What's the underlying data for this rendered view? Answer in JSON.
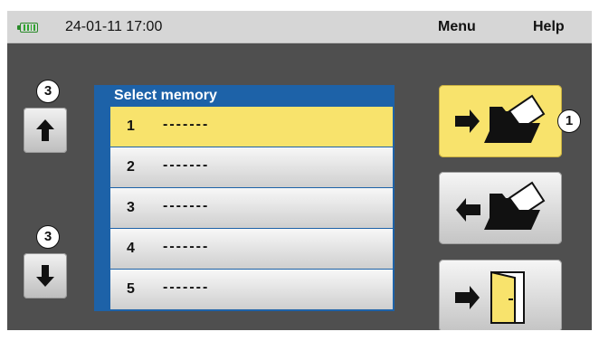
{
  "status_bar": {
    "datetime": "24-01-11 17:00",
    "menu_label": "Menu",
    "help_label": "Help",
    "battery_icon": "battery-icon"
  },
  "callouts": {
    "up": "3",
    "down": "3",
    "save": "1"
  },
  "memory_list": {
    "title": "Select memory",
    "selected_index": 0,
    "items": [
      {
        "number": "1",
        "value": "-------"
      },
      {
        "number": "2",
        "value": "-------"
      },
      {
        "number": "3",
        "value": "-------"
      },
      {
        "number": "4",
        "value": "-------"
      },
      {
        "number": "5",
        "value": "-------"
      }
    ]
  },
  "buttons": {
    "scroll_up_icon": "arrow-up-icon",
    "scroll_down_icon": "arrow-down-icon",
    "save_icon": "arrow-into-folder-icon",
    "load_icon": "arrow-out-of-folder-icon",
    "exit_icon": "arrow-into-door-icon"
  },
  "colors": {
    "highlight": "#f8e36c",
    "list_frame": "#1d62a8",
    "screen_bg": "#4f4f4f",
    "battery": "#2ea52e"
  }
}
